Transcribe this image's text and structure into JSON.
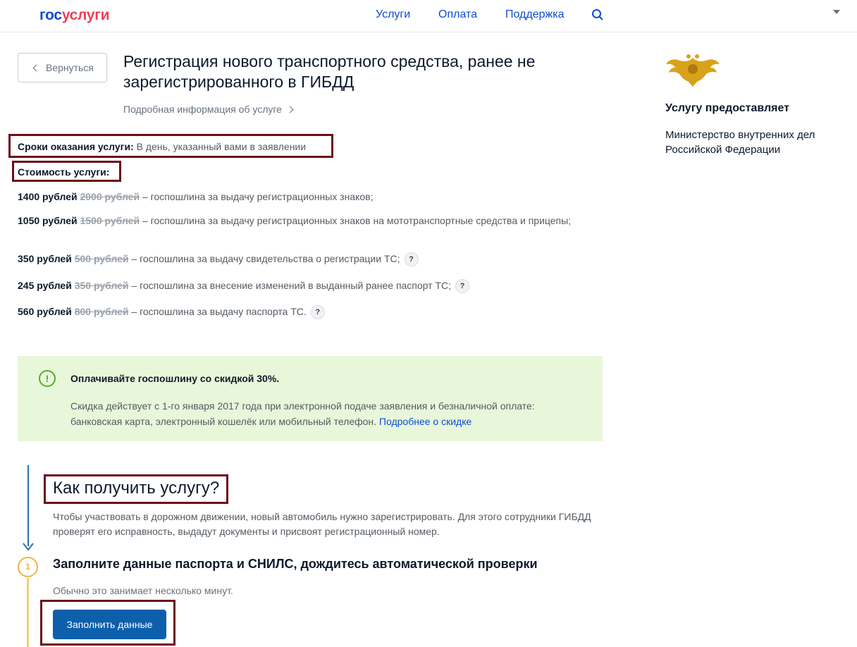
{
  "header": {
    "logo_part1": "гос",
    "logo_part2": "услуги",
    "nav": [
      "Услуги",
      "Оплата",
      "Поддержка"
    ]
  },
  "back_label": "Вернуться",
  "page_title": "Регистрация нового транспортного средства, ранее не зарегистрированного в ГИБДД",
  "info_link": "Подробная информация об услуге",
  "term": {
    "label": "Сроки оказания услуги:",
    "value": "В день, указанный вами в заявлении"
  },
  "cost_label": "Стоимость услуги:",
  "fees": [
    {
      "price": "1400 рублей",
      "old": "2000 рублей",
      "desc": "– госпошлина за выдачу регистрационных знаков;",
      "help": false
    },
    {
      "price": "1050 рублей",
      "old": "1500 рублей",
      "desc": "– госпошлина за выдачу регистрационных знаков на мототранспортные средства и прицепы;",
      "help": false
    },
    {
      "price": "350 рублей",
      "old": "500 рублей",
      "desc": "– госпошлина за выдачу свидетельства о регистрации ТС;",
      "help": true
    },
    {
      "price": "245 рублей",
      "old": "350 рублей",
      "desc": "– госпошлина за внесение изменений в выданный ранее паспорт ТС;",
      "help": true
    },
    {
      "price": "560 рублей",
      "old": "800 рублей",
      "desc": "– госпошлина за выдачу паспорта ТС.",
      "help": true
    }
  ],
  "help_glyph": "?",
  "discount": {
    "title": "Оплачивайте госпошлину со скидкой 30%.",
    "text": "Скидка действует с 1-го января 2017 года при электронной подаче заявления и безналичной оплате: банковская карта, электронный кошелёк или мобильный телефон.",
    "link": "Подробнее о скидке",
    "glyph": "!"
  },
  "how": {
    "title": "Как получить услугу?",
    "desc": "Чтобы участвовать в дорожном движении, новый автомобиль нужно зарегистрировать. Для этого сотрудники ГИБДД проверят его исправность, выдадут документы и присвоят регистрационный номер."
  },
  "step1": {
    "num": "1",
    "title": "Заполните данные паспорта и СНИЛС, дождитесь автоматической проверки",
    "desc": "Обычно это занимает несколько минут.",
    "button": "Заполнить данные"
  },
  "sidebar": {
    "title": "Услугу предоставляет",
    "provider": "Министерство внутренних дел Российской Федерации"
  },
  "colors": {
    "accent": "#0d4cd3",
    "logo_red": "#ee3f58",
    "highlight": "#6b0d1b",
    "discount_bg": "#e8f7da",
    "button": "#0d5fab"
  }
}
